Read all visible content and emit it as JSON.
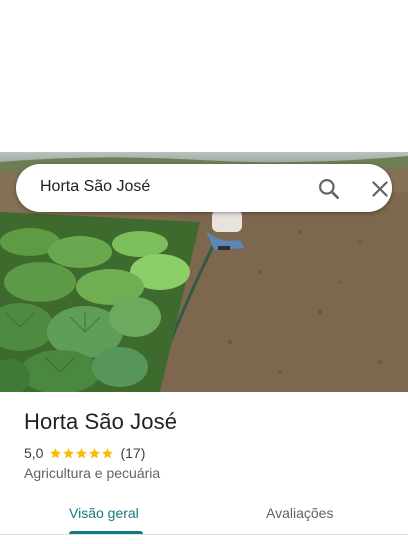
{
  "search": {
    "query": "Horta São José"
  },
  "place": {
    "name": "Horta São José",
    "rating": "5,0",
    "stars": 5,
    "review_count": "(17)",
    "category": "Agricultura e pecuária"
  },
  "tabs": [
    {
      "label": "Visão geral",
      "active": true
    },
    {
      "label": "Avaliações",
      "active": false
    }
  ],
  "colors": {
    "accent": "#137a82",
    "star": "#fbbc04"
  }
}
